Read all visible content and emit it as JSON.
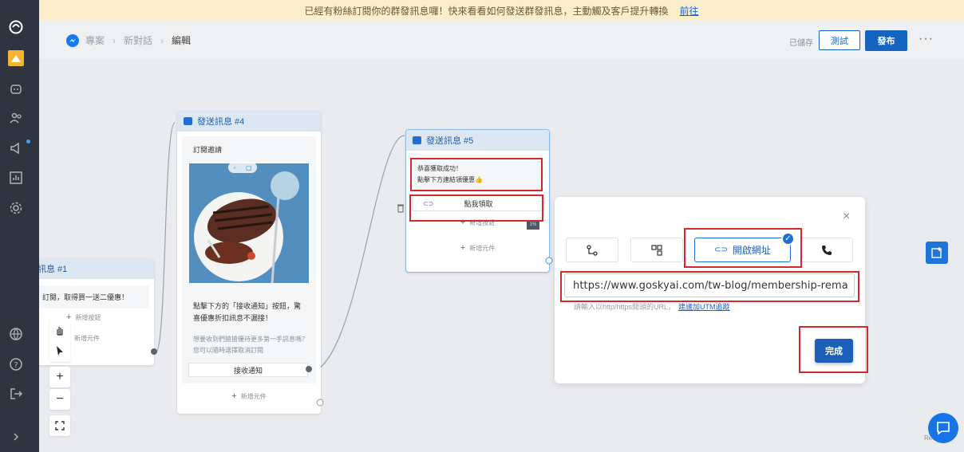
{
  "notice": {
    "text": "已經有粉絲訂閱你的群發訊息囉！快來看看如何發送群發訊息，主動觸及客戶提升轉換",
    "link": "前往"
  },
  "breadcrumb": {
    "items": [
      "專案",
      "新對話",
      "編輯"
    ]
  },
  "header": {
    "saved": "已儲存",
    "test_label": "測試",
    "publish_label": "發布",
    "more": "···"
  },
  "card1": {
    "title": "訊息 #1",
    "text": "訂閱，取得買一送二優惠！",
    "button_add": "新增按鈕",
    "add_element": "新增元件"
  },
  "card4": {
    "title": "發送訊息 #4",
    "heading": "訂閱邀請",
    "body": "點擊下方的「接收通知」按鈕，驚喜優惠折扣訊息不漏接！",
    "note": "想要收到們搶搶優待更多第一手訊息嗎？您可以隨時選擇取消訂閱",
    "button_label": "接收通知",
    "add_element": "新增元件"
  },
  "card5": {
    "title": "發送訊息 #5",
    "text_line1": "恭喜獲取成功！",
    "text_line2": "點擊下方連結領優惠👍",
    "button_label": "點我領取",
    "button_add": "新增按鈕",
    "add_element": "新增元件",
    "badge": "1%"
  },
  "popover": {
    "selected_option": "開啟網址",
    "url_value": "https://www.goskyai.com/tw-blog/membership-rema",
    "hint": "請輸入以http/https開頭的URL，",
    "utm_link": "建議加UTM追蹤",
    "done_label": "完成",
    "close": "×",
    "check": "✓"
  },
  "tools": {
    "zoom_in": "+",
    "zoom_out": "−"
  },
  "footer": {
    "rv": "Re"
  },
  "colors": {
    "accent": "#1565c0",
    "highlight": "#d4282e",
    "rail": "#2e3440",
    "notice_bg": "#fbeeca"
  }
}
